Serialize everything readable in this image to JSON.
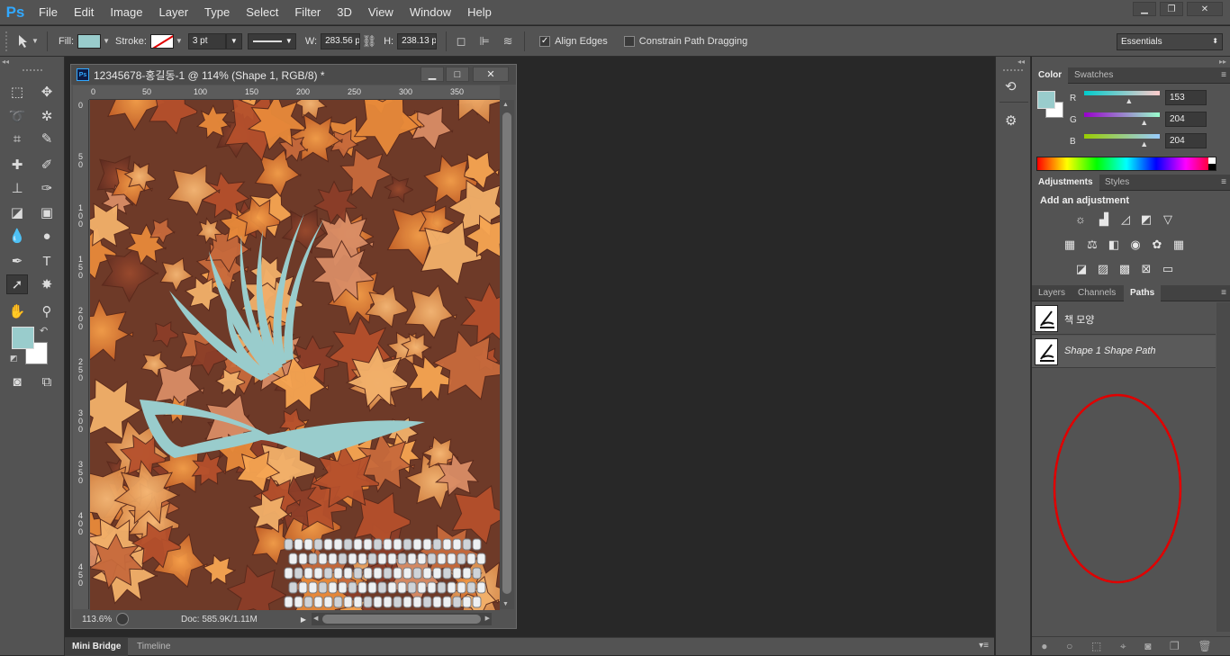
{
  "app": {
    "logo": "Ps"
  },
  "menu": [
    "File",
    "Edit",
    "Image",
    "Layer",
    "Type",
    "Select",
    "Filter",
    "3D",
    "View",
    "Window",
    "Help"
  ],
  "window_controls": {
    "minimize": "▁",
    "restore": "❐",
    "close": "✕"
  },
  "options_bar": {
    "tool_icon": "path-selection-icon",
    "fill_label": "Fill:",
    "fill_color": "#99cccc",
    "stroke_label": "Stroke:",
    "stroke_width": "3 pt",
    "w_label": "W:",
    "w_value": "283.56 p",
    "h_label": "H:",
    "h_value": "238.13 p",
    "align_edges_label": "Align Edges",
    "align_edges_checked": true,
    "constrain_label": "Constrain Path Dragging",
    "constrain_checked": false,
    "workspace": "Essentials"
  },
  "document": {
    "title": "12345678-홍길동-1 @ 114% (Shape 1, RGB/8) *",
    "ruler_h": [
      "0",
      "50",
      "100",
      "150",
      "200",
      "250",
      "300",
      "350"
    ],
    "ruler_v": [
      "0",
      "5\n0",
      "1\n0\n0",
      "1\n5\n0",
      "2\n0\n0",
      "2\n5\n0",
      "3\n0\n0",
      "3\n5\n0",
      "4\n0\n0",
      "4\n5\n0"
    ],
    "zoom": "113.6%",
    "doc_info": "Doc: 585.9K/1.11M"
  },
  "colors": {
    "foreground": "#99cccc",
    "background": "#ffffff",
    "accent": "#31a8ff",
    "annotation": "#e00000"
  },
  "bottom_tabs": [
    "Mini Bridge",
    "Timeline"
  ],
  "color_panel": {
    "tabs": [
      "Color",
      "Swatches"
    ],
    "r_label": "R",
    "r_value": "153",
    "r_fraction": 0.6,
    "g_label": "G",
    "g_value": "204",
    "g_fraction": 0.8,
    "b_label": "B",
    "b_value": "204",
    "b_fraction": 0.8
  },
  "adjustments_panel": {
    "tabs": [
      "Adjustments",
      "Styles"
    ],
    "heading": "Add an adjustment",
    "icons": [
      "brightness-contrast-icon",
      "levels-icon",
      "curves-icon",
      "exposure-icon",
      "vibrance-icon",
      "hue-saturation-icon",
      "color-balance-icon",
      "black-white-icon",
      "photo-filter-icon",
      "channel-mixer-icon",
      "color-lookup-icon",
      "invert-icon",
      "posterize-icon",
      "threshold-icon",
      "selective-color-icon",
      "gradient-map-icon"
    ]
  },
  "paths_panel": {
    "tabs": [
      "Layers",
      "Channels",
      "Paths"
    ],
    "paths": [
      {
        "name": "책 모양",
        "italic": false
      },
      {
        "name": "Shape 1 Shape Path",
        "italic": true
      }
    ],
    "footer_icons": [
      "fill-path-icon",
      "stroke-path-icon",
      "load-selection-icon",
      "make-work-path-icon",
      "add-mask-icon",
      "new-path-icon",
      "delete-path-icon"
    ]
  }
}
